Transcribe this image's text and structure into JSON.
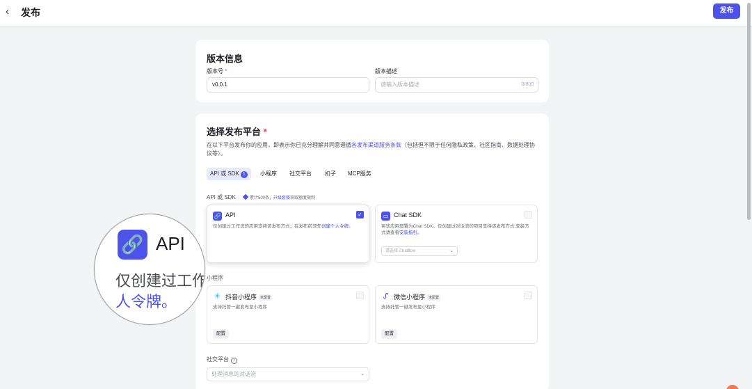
{
  "header": {
    "back_icon": "chevron-left-icon",
    "title": "发布",
    "publish_label": "发布"
  },
  "version": {
    "title": "版本信息",
    "number_label": "版本号",
    "required_mark": "*",
    "number_value": "v0.0.1",
    "desc_label": "版本描述",
    "desc_placeholder": "请输入版本描述",
    "desc_counter": "0/800"
  },
  "platform": {
    "title": "选择发布平台",
    "required_mark": "*",
    "desc_before": "在以下平台发布你的应用，即表示你已充分理解并同意遵循",
    "desc_link": "各发布渠道服务条款",
    "desc_after": "（包括但不限于任何隐私政策、社区指南、数据处理协议等）。",
    "tabs": [
      {
        "label": "API 或 SDK",
        "badge": "1"
      },
      {
        "label": "小程序"
      },
      {
        "label": "社交平台"
      },
      {
        "label": "扣子"
      },
      {
        "label": "MCP服务"
      }
    ],
    "api_section": {
      "title": "API 或 SDK",
      "quota_text": "累计500条，",
      "quota_link": "升级套餐",
      "quota_after": "获取额度限制"
    },
    "api_card": {
      "icon": "link-icon",
      "name": "API",
      "desc_text": "仅创建过工作流的应用支持该发布方式；在发布前须先",
      "desc_link": "创建个人令牌。",
      "checked": true
    },
    "chatsdk_card": {
      "icon": "chat-window-icon",
      "name": "Chat SDK",
      "desc_text": "将该应用部署为Chat SDK。仅创建过对话流的项目支持该发布方式,安装方式请查看",
      "desc_link": "安装指引。",
      "select_placeholder": "请选择 Chatflow"
    },
    "mini_section": {
      "title": "小程序"
    },
    "douyin_card": {
      "icon": "douyin-icon",
      "name": "抖音小程序",
      "badge": "未配置",
      "desc": "支持托管一键发布至小程序",
      "config_label": "配置"
    },
    "wechat_card": {
      "icon": "wechat-mini-icon",
      "name": "微信小程序",
      "badge": "未配置",
      "desc": "支持托管一键发布至小程序",
      "config_label": "配置"
    },
    "social_section": {
      "title": "社交平台",
      "select_placeholder": "处理消息的对话流"
    }
  },
  "magnifier": {
    "name": "API",
    "line1": "仅创建过工作",
    "line2": "人令牌。"
  },
  "colors": {
    "accent": "#4d53e8",
    "required": "#e5484d"
  }
}
